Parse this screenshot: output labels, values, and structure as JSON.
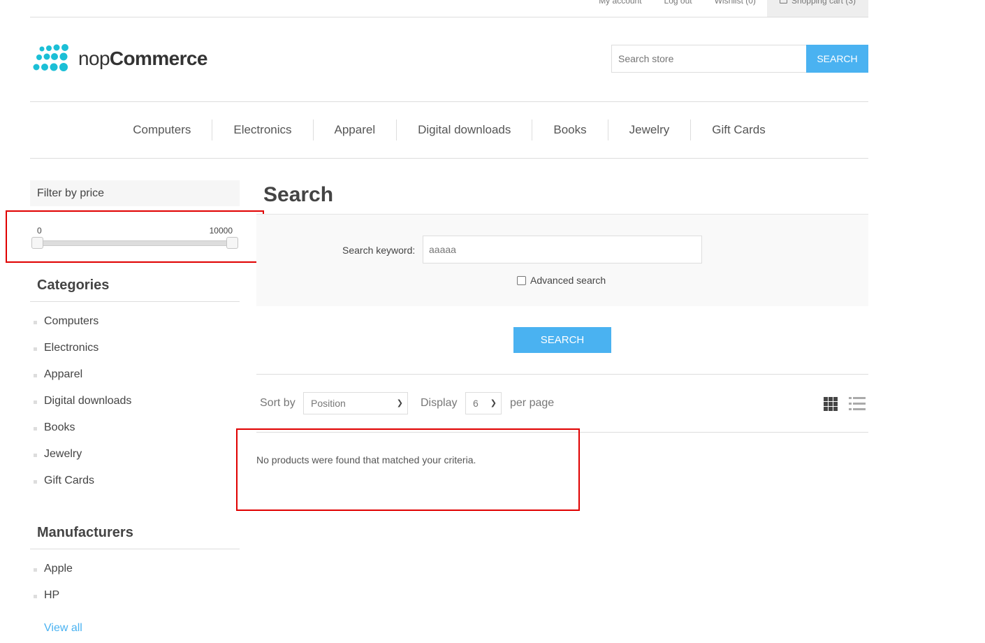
{
  "header_links": {
    "my_account": "My account",
    "log_out": "Log out",
    "wishlist": "Wishlist (0)",
    "shopping_cart": "Shopping cart (3)"
  },
  "logo": {
    "text_light": "nop",
    "text_bold": "Commerce",
    "color": "#1bbfd6"
  },
  "store_search": {
    "placeholder": "Search store",
    "button": "SEARCH"
  },
  "top_menu": [
    "Computers",
    "Electronics",
    "Apparel",
    "Digital downloads",
    "Books",
    "Jewelry",
    "Gift Cards"
  ],
  "sidebar": {
    "filter_title": "Filter by price",
    "price_min": "0",
    "price_max": "10000",
    "categories_title": "Categories",
    "categories": [
      "Computers",
      "Electronics",
      "Apparel",
      "Digital downloads",
      "Books",
      "Jewelry",
      "Gift Cards"
    ],
    "manufacturers_title": "Manufacturers",
    "manufacturers": [
      "Apple",
      "HP"
    ],
    "view_all": "View all"
  },
  "main": {
    "title": "Search",
    "keyword_label": "Search keyword:",
    "keyword_value": "aaaaa",
    "advanced_search": "Advanced search",
    "search_button": "SEARCH",
    "sort_by": "Sort by",
    "sort_value": "Position",
    "display": "Display",
    "display_value": "6",
    "per_page": "per page",
    "no_results": "No products were found that matched your criteria."
  },
  "colors": {
    "accent": "#4ab2f1",
    "highlight": "#e00000"
  }
}
